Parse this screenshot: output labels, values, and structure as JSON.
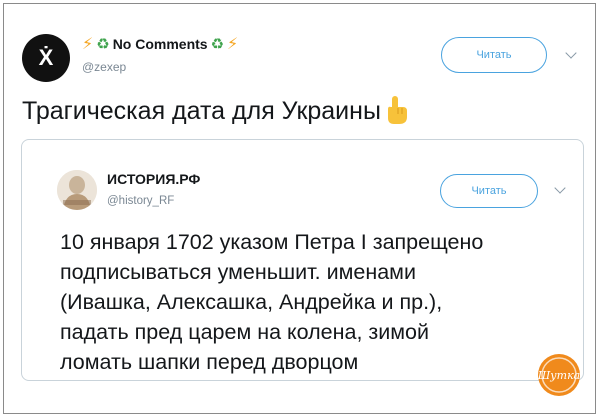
{
  "tweet": {
    "display_name": "No Comments",
    "handle": "@zexep",
    "avatar_letter": "Ẋ",
    "follow_label": "Читать",
    "text": "Трагическая дата для Украины"
  },
  "quoted": {
    "display_name": "ИСТОРИЯ.РФ",
    "handle": "@history_RF",
    "follow_label": "Читать",
    "lines": [
      "10 января 1702 указом Петра I запрещено",
      "подписываться уменьшит. именами",
      "(Ивашка, Алексашка, Андрейка и пр.),",
      "падать пред царем на колена, зимой",
      "ломать шапки перед дворцом"
    ]
  },
  "watermark": {
    "text": "Шутка"
  },
  "colors": {
    "accent": "#4aa3df",
    "bolt": "#f5a623",
    "recycle": "#3fa34d",
    "watermark": "#f08a1c"
  }
}
